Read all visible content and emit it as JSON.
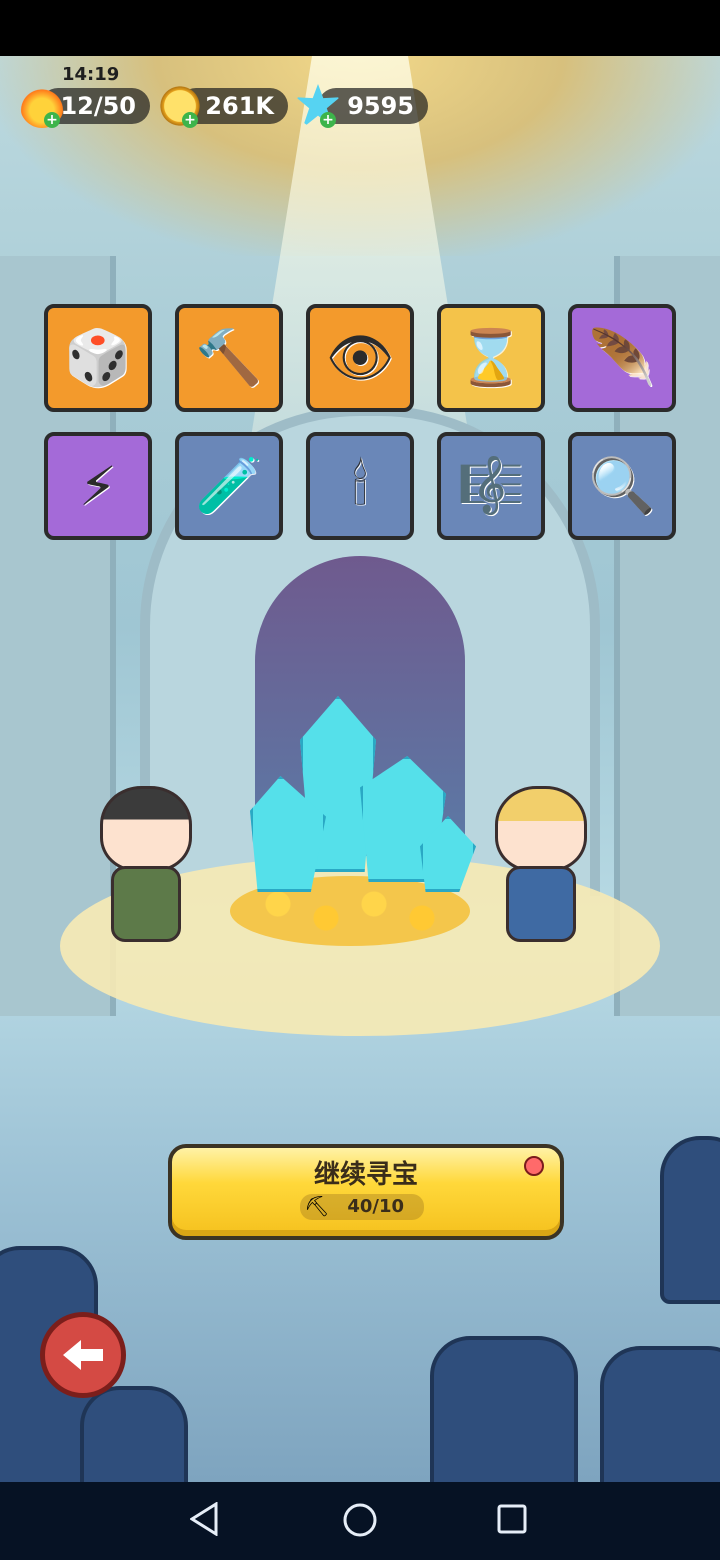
{
  "status": {
    "time": "14:19"
  },
  "resources": {
    "energy": {
      "value": "12/50",
      "icon": "fire-icon"
    },
    "gold": {
      "value": "261K",
      "icon": "coin-icon"
    },
    "gems": {
      "value": "9595",
      "icon": "gem-icon"
    }
  },
  "relics": [
    {
      "name": "d20-dice-icon",
      "glyph": "🎲",
      "color": "orange"
    },
    {
      "name": "hammer-icon",
      "glyph": "🔨",
      "color": "orange"
    },
    {
      "name": "eye-tome-icon",
      "glyph": "👁",
      "color": "orange"
    },
    {
      "name": "hourglass-vase-icon",
      "glyph": "⌛",
      "color": "yellow"
    },
    {
      "name": "phoenix-feather-icon",
      "glyph": "🪶",
      "color": "purple"
    },
    {
      "name": "lightning-scroll-icon",
      "glyph": "⚡",
      "color": "purple"
    },
    {
      "name": "potion-vial-icon",
      "glyph": "🧪",
      "color": "blue"
    },
    {
      "name": "candle-icon",
      "glyph": "🕯",
      "color": "blue"
    },
    {
      "name": "lyre-icon",
      "glyph": "🎼",
      "color": "blue"
    },
    {
      "name": "magnifier-icon",
      "glyph": "🔍",
      "color": "blue"
    }
  ],
  "continue_button": {
    "label": "继续寻宝",
    "cost": "40/10"
  },
  "colors": {
    "accent": "#f5c11e",
    "back_button": "#d44a44"
  }
}
